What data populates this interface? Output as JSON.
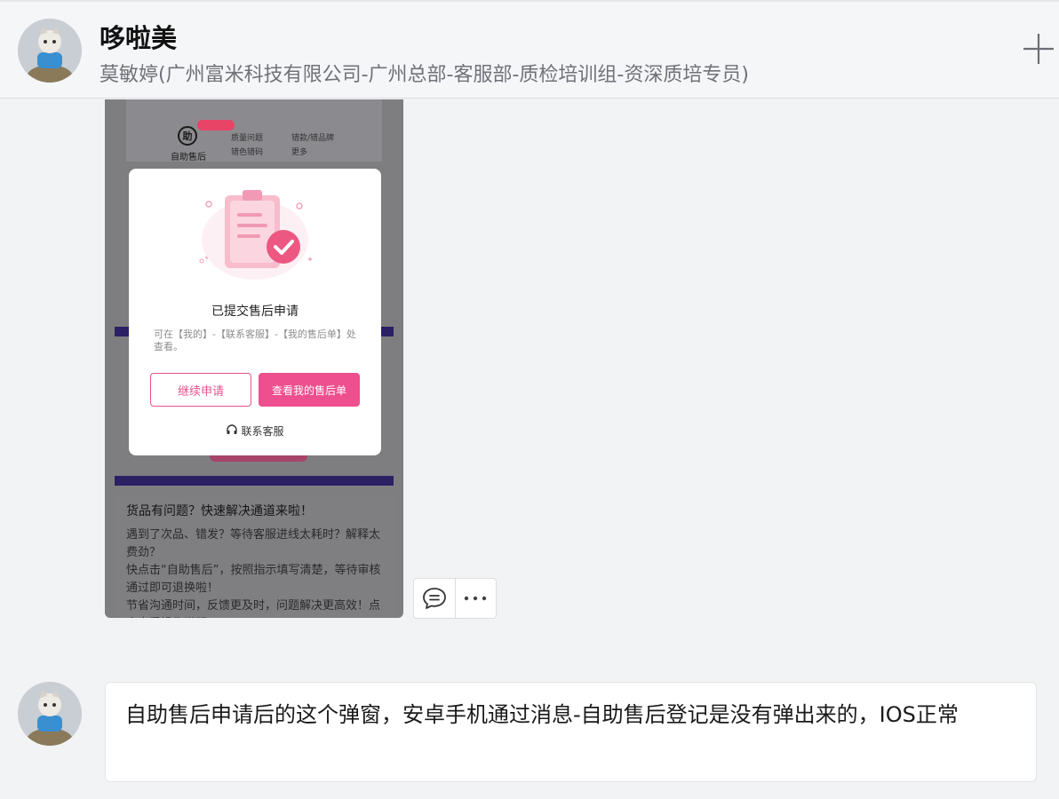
{
  "header": {
    "name": "哆啦美",
    "subtitle": "莫敏婷(广州富米科技有限公司-广州总部-客服部-质检培训组-资深质培专员)"
  },
  "screenshot": {
    "aftersale_label": "自助售后",
    "aftersale_icon_text": "助",
    "options": [
      "质量问题",
      "错款/错品牌",
      "错色错码",
      "更多"
    ],
    "modal": {
      "title": "已提交售后申请",
      "desc": "可在【我的】-【联系客服】-【我的售后单】处查看。",
      "continue_label": "继续申请",
      "view_label": "查看我的售后单",
      "contact_label": "联系客服"
    },
    "lower_title": "货品有问题？快速解决通道来啦！",
    "lower_body": "遇到了次品、错发？等待客服进线太耗时？解释太费劲？\n快点击“自助售后”，按照指示填写清楚，等待审核通过即可退换啦！\n节省沟通时间，反馈更及时，问题解决更高效！点击查看操作说明"
  },
  "message2": {
    "text": "自助售后申请后的这个弹窗，安卓手机通过消息-自助售后登记是没有弹出来的，IOS正常"
  },
  "icons": {
    "plus": "plus-icon",
    "comment": "comment-icon",
    "more": "more-icon",
    "headset": "headset-icon"
  },
  "colors": {
    "accent_pink": "#ee4f8f",
    "overlay_gray": "#7e7e81"
  }
}
